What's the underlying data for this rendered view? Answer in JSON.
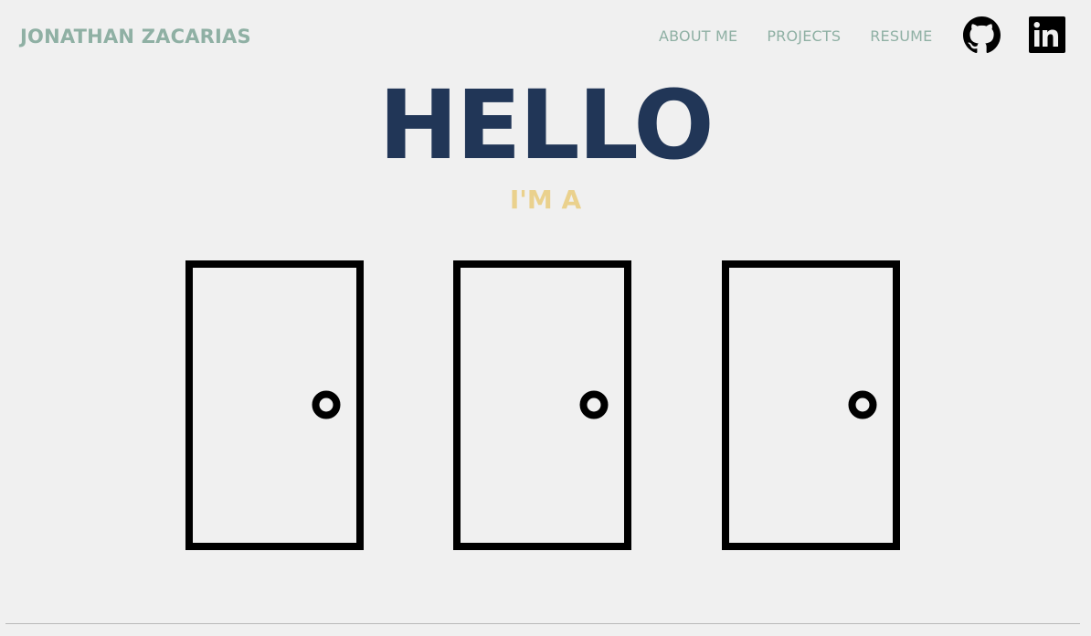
{
  "header": {
    "brand": "JONATHAN ZACARIAS",
    "nav": [
      {
        "label": "ABOUT ME"
      },
      {
        "label": "PROJECTS"
      },
      {
        "label": "RESUME"
      }
    ],
    "social": [
      {
        "icon": "github-icon"
      },
      {
        "icon": "linkedin-icon"
      }
    ]
  },
  "hero": {
    "title": "HELLO",
    "subtitle": "I'M A"
  },
  "doors": [
    {
      "icon": "door-icon"
    },
    {
      "icon": "door-icon"
    },
    {
      "icon": "door-icon"
    }
  ],
  "colors": {
    "background": "#f0f0f0",
    "brand": "#8fb0a4",
    "title": "#213657",
    "subtitle": "#ead18d",
    "door": "#000000"
  }
}
